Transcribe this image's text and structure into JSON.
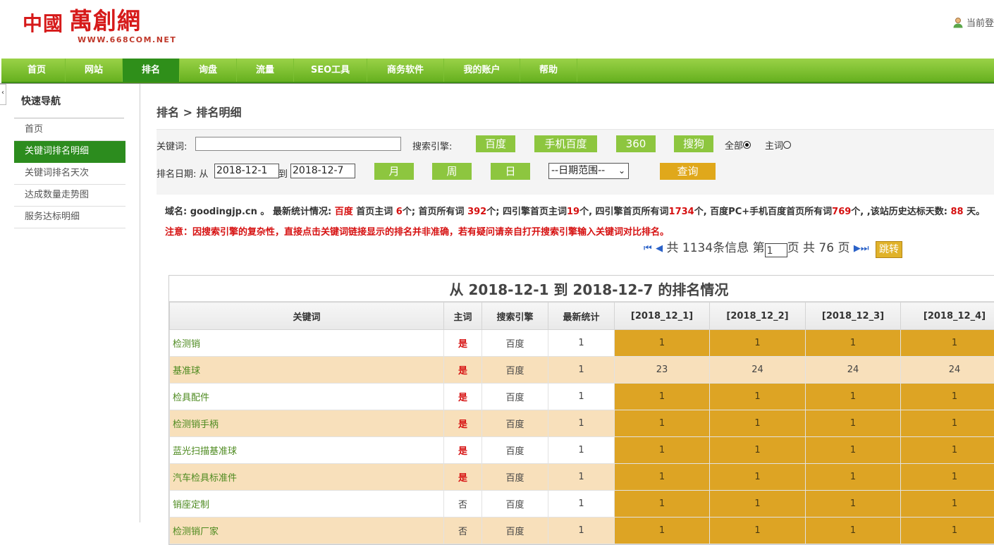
{
  "header": {
    "logo_cn": "中國",
    "logo_brand": "萬創網",
    "logo_url": "WWW.668COM.NET",
    "user_text": "当前登"
  },
  "nav": {
    "items": [
      "首页",
      "网站",
      "排名",
      "询盘",
      "流量",
      "SEO工具",
      "商务软件",
      "我的账户",
      "帮助"
    ],
    "active": "排名"
  },
  "sidebar": {
    "title": "快速导航",
    "items": [
      "首页",
      "关键词排名明细",
      "关键词排名天次",
      "达成数量走势图",
      "服务达标明细"
    ],
    "active": "关键词排名明细"
  },
  "breadcrumb": "排名 > 排名明细",
  "filter": {
    "keyword_label": "关键词:",
    "keyword_value": "",
    "engine_label": "搜索引擎:",
    "engines": [
      "百度",
      "手机百度",
      "360",
      "搜狗"
    ],
    "radio_all": "全部",
    "radio_main": "主词",
    "date_label": "排名日期: 从",
    "date_from": "2018-12-1",
    "date_to_label": "到",
    "date_to": "2018-12-7",
    "period_buttons": [
      "月",
      "周",
      "日"
    ],
    "range_select": "--日期范围--",
    "query_button": "查询"
  },
  "stats": {
    "domain_label": "域名:",
    "domain": "goodingjp.cn",
    "after_domain": "。 最新统计情况:",
    "engine": "百度",
    "t1": "首页主词",
    "home_main": "6",
    "t2": "个; 首页所有词",
    "home_all": "392",
    "t3": "个; 四引擎首页主词",
    "four_main": "19",
    "t4": "个, 四引擎首页所有词",
    "four_all": "1734",
    "t5": "个, 百度PC+手机百度首页所有词",
    "pc_mobile": "769",
    "t6": "个, ,该站历史达标天数:",
    "days": "88",
    "t7": "天。"
  },
  "notice": "注意：因搜索引擎的复杂性，直接点击关键词链接显示的排名并非准确，若有疑问请亲自打开搜索引擎输入关键词对比排名。",
  "pager": {
    "text_total_prefix": "共",
    "total": "1134",
    "text_total_suffix": "条信息 第",
    "page": "1",
    "text_pages_prefix": "页 共",
    "pages": "76",
    "text_pages_suffix": "页",
    "jump": "跳转"
  },
  "table": {
    "title": "从 2018-12-1 到 2018-12-7 的排名情况",
    "headers": [
      "关键词",
      "主词",
      "搜索引擎",
      "最新统计",
      "[2018_12_1]",
      "[2018_12_2]",
      "[2018_12_3]",
      "[2018_12_4]"
    ],
    "rows": [
      {
        "kw": "检测销",
        "main": "是",
        "engine": "百度",
        "latest": "1",
        "d": [
          "1",
          "1",
          "1",
          "1"
        ],
        "gold": true
      },
      {
        "kw": "基准球",
        "main": "是",
        "engine": "百度",
        "latest": "1",
        "d": [
          "23",
          "24",
          "24",
          "24"
        ],
        "gold": false
      },
      {
        "kw": "检具配件",
        "main": "是",
        "engine": "百度",
        "latest": "1",
        "d": [
          "1",
          "1",
          "1",
          "1"
        ],
        "gold": true
      },
      {
        "kw": "检测销手柄",
        "main": "是",
        "engine": "百度",
        "latest": "1",
        "d": [
          "1",
          "1",
          "1",
          "1"
        ],
        "gold": true
      },
      {
        "kw": "蓝光扫描基准球",
        "main": "是",
        "engine": "百度",
        "latest": "1",
        "d": [
          "1",
          "1",
          "1",
          "1"
        ],
        "gold": true
      },
      {
        "kw": "汽车检具标准件",
        "main": "是",
        "engine": "百度",
        "latest": "1",
        "d": [
          "1",
          "1",
          "1",
          "1"
        ],
        "gold": true
      },
      {
        "kw": "销座定制",
        "main": "否",
        "engine": "百度",
        "latest": "1",
        "d": [
          "1",
          "1",
          "1",
          "1"
        ],
        "gold": true
      },
      {
        "kw": "检测销厂家",
        "main": "否",
        "engine": "百度",
        "latest": "1",
        "d": [
          "1",
          "1",
          "1",
          "1"
        ],
        "gold": true
      }
    ]
  },
  "colors": {
    "nav_green": "#66b01f",
    "active_green": "#2c8c1e",
    "gold": "#dda424",
    "stripe": "#f8e0bb",
    "red": "#d61111"
  }
}
